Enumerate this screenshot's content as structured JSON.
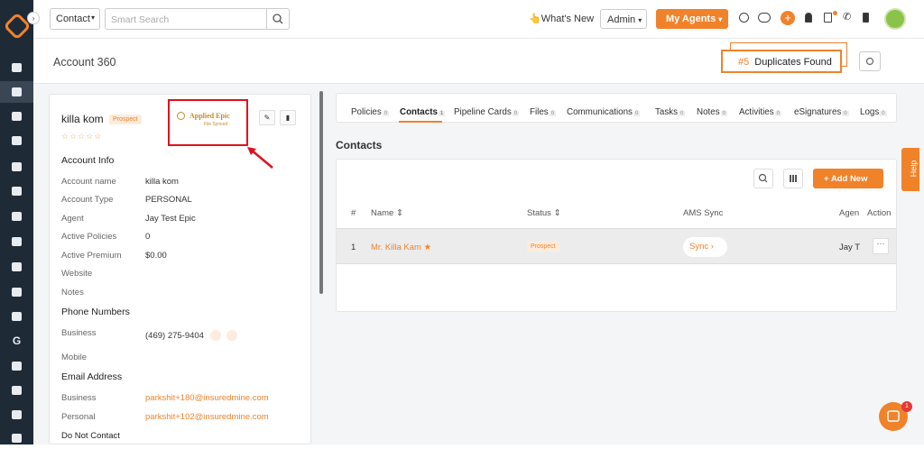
{
  "topbar": {
    "select_value": "Contact",
    "search_placeholder": "Smart Search",
    "whats_new": "👆What's New",
    "admin": "Admin",
    "my_agents": "My Agents",
    "notification_count": ""
  },
  "header": {
    "title": "Account 360",
    "dup_number": "#5",
    "dup_label": "Duplicates Found"
  },
  "account": {
    "name": "killa kom",
    "status": "Prospect",
    "stars": "☆☆☆☆☆",
    "ams_logo_line1": "Applied Epic",
    "ams_logo_line2": "File Synced",
    "info_title": "Account Info",
    "fields": [
      {
        "label": "Account name",
        "value": "killa kom"
      },
      {
        "label": "Account Type",
        "value": "PERSONAL"
      },
      {
        "label": "Agent",
        "value": "Jay Test Epic"
      },
      {
        "label": "Active Policies",
        "value": "0"
      },
      {
        "label": "Active Premium",
        "value": "$0.00"
      },
      {
        "label": "Website",
        "value": ""
      },
      {
        "label": "Notes",
        "value": ""
      }
    ],
    "phone_title": "Phone Numbers",
    "phones": [
      {
        "label": "Business",
        "value": "(469) 275-9404"
      },
      {
        "label": "Mobile",
        "value": ""
      }
    ],
    "email_title": "Email Address",
    "emails": [
      {
        "label": "Business",
        "value": "parkshit+180@insuredmine.com"
      },
      {
        "label": "Personal",
        "value": "parkshit+102@insuredmine.com"
      }
    ],
    "dnc_label": "Do Not Contact"
  },
  "tabs": [
    {
      "label": "Policies",
      "count": "0"
    },
    {
      "label": "Contacts",
      "count": "1"
    },
    {
      "label": "Pipeline Cards",
      "count": "0"
    },
    {
      "label": "Files",
      "count": "0"
    },
    {
      "label": "Communications",
      "count": "0"
    },
    {
      "label": "Tasks",
      "count": "0"
    },
    {
      "label": "Notes",
      "count": "0"
    },
    {
      "label": "Activities",
      "count": "0"
    },
    {
      "label": "eSignatures",
      "count": "0"
    },
    {
      "label": "Logs",
      "count": "0"
    }
  ],
  "contacts": {
    "title": "Contacts",
    "add_new": "+ Add New",
    "columns": [
      "#",
      "Name ⇕",
      "Status ⇕",
      "AMS Sync",
      "Agen",
      "Action"
    ],
    "rows": [
      {
        "num": "1",
        "name": "Mr. Killa Kam ★",
        "status": "Prospect",
        "sync": "Sync  ›",
        "agent": "Jay T",
        "action": "···"
      }
    ]
  },
  "help_label": "Help",
  "chat_badge": "1",
  "colors": {
    "accent": "#f0822a",
    "sidebar": "#1f2a37",
    "annotation": "#e0101e"
  },
  "sidebar_icons": [
    "dashboard-icon",
    "contacts-icon",
    "policies-icon",
    "bank-icon",
    "list-icon",
    "id-card-icon",
    "funnel-icon",
    "megaphone-icon",
    "document-icon",
    "chart-icon",
    "folder-icon",
    "google-icon",
    "calendar-grid-icon",
    "calendar-icon",
    "mail-icon",
    "sign-icon"
  ]
}
